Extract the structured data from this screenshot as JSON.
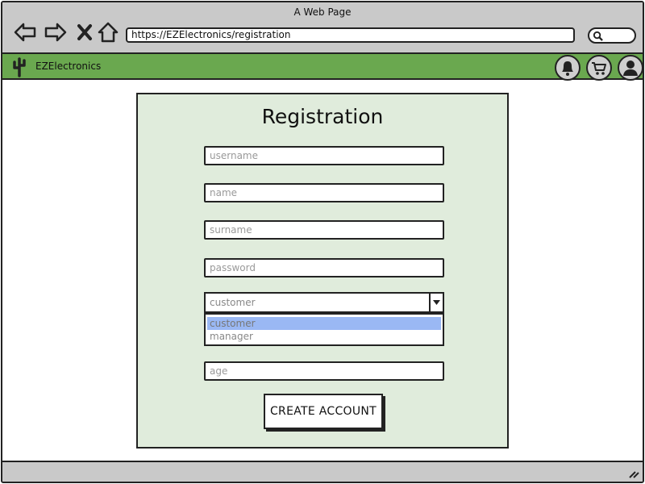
{
  "window": {
    "title": "A Web Page"
  },
  "browser": {
    "url": "https://EZElectronics/registration",
    "icons": [
      "back-arrow-icon",
      "forward-arrow-icon",
      "close-x-icon",
      "home-icon",
      "search-icon"
    ]
  },
  "app": {
    "brand": "EZElectronics",
    "icons": [
      "cactus-logo-icon",
      "bell-icon",
      "cart-icon",
      "user-icon"
    ],
    "accent": "#6aa84f"
  },
  "form": {
    "title": "Registration",
    "username_placeholder": "username",
    "name_placeholder": "name",
    "surname_placeholder": "surname",
    "password_placeholder": "password",
    "role_value": "customer",
    "role_options": [
      "customer",
      "manager"
    ],
    "age_placeholder": "age",
    "submit_label": "CREATE ACCOUNT",
    "background": "#e0ecdc",
    "highlight": "#9ab8f4"
  }
}
